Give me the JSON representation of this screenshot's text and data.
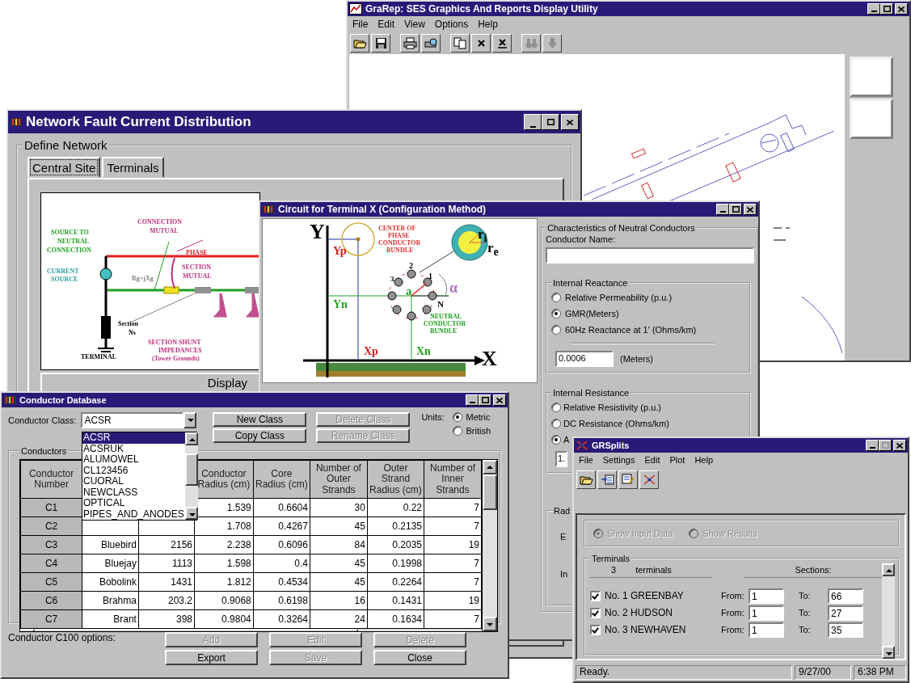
{
  "grarep": {
    "title": "GraRep: SES Graphics And Reports Display Utility",
    "menu": [
      "File",
      "Edit",
      "View",
      "Options",
      "Help"
    ]
  },
  "network": {
    "title": "Network Fault Current Distribution",
    "group": "Define Network",
    "tabs": [
      {
        "label": "Central Site",
        "selected": true
      },
      {
        "label": "Terminals",
        "selected": false
      }
    ],
    "diagram_labels": [
      "SOURCE TO",
      "NEUTRAL",
      "CONNECTION",
      "CONNECTION",
      "MUTUAL",
      "PHASE",
      "CURRENT",
      "SOURCE",
      "Rg+jXg",
      "SECTION",
      "MUTUAL",
      "Section",
      "Ns",
      "SECTION SHUNT",
      "IMPEDANCES",
      "TERMINAL",
      "(Tower Grounds)"
    ],
    "display_button": "Display"
  },
  "circuit": {
    "title": "Circuit for Terminal X (Configuration Method)",
    "diagram_labels": [
      "Y",
      "Yp",
      "CENTER OF",
      "PHASE",
      "CONDUCTOR",
      "BUNDLE",
      "r$_{i}$",
      "r$_{e}$",
      "Yn",
      "2",
      "3",
      "1",
      "a",
      "α",
      "N",
      "NEUTRAL",
      "CONDUCTOR",
      "BUNDLE",
      "Xp",
      "Xn",
      "X"
    ],
    "group": "Characteristics of Neutral Conductors",
    "name_label": "Conductor Name:",
    "reactance": {
      "title": "Internal Reactance",
      "options": [
        {
          "label": "Relative Permeability (p.u.)",
          "selected": false
        },
        {
          "label": "GMR(Meters)",
          "selected": true
        },
        {
          "label": "60Hz Reactance at 1' (Ohms/km)",
          "selected": false
        }
      ],
      "value": "0.0006",
      "unit": "(Meters)"
    },
    "resistance": {
      "title": "Internal Resistance",
      "options": [
        {
          "label": "Relative Resistivity (p.u.)",
          "selected": false
        },
        {
          "label": "DC Resistance (Ohms/km)",
          "selected": false
        },
        {
          "label": "A",
          "selected": true
        }
      ],
      "value": "1."
    },
    "radius": {
      "title": "Rad",
      "lines": [
        "E",
        "In"
      ]
    }
  },
  "conductor_db": {
    "title": "Conductor Database",
    "class_label": "Conductor Class:",
    "class_value": "ACSR",
    "class_options": [
      {
        "label": "ACSR",
        "selected": true
      },
      {
        "label": "ACSRUK",
        "selected": false
      },
      {
        "label": "ALUMOWEL",
        "selected": false
      },
      {
        "label": "CL123456",
        "selected": false
      },
      {
        "label": "CUORAL",
        "selected": false
      },
      {
        "label": "NEWCLASS",
        "selected": false
      },
      {
        "label": "OPTICAL",
        "selected": false
      },
      {
        "label": "PIPES_AND_ANODES",
        "selected": false
      }
    ],
    "top_buttons": [
      {
        "label": "New Class",
        "disabled": false
      },
      {
        "label": "Delete Class",
        "disabled": true
      },
      {
        "label": "Copy Class",
        "disabled": false
      },
      {
        "label": "Rename Class",
        "disabled": true
      }
    ],
    "units_label": "Units:",
    "units": [
      {
        "label": "Metric",
        "selected": true
      },
      {
        "label": "British",
        "selected": false
      }
    ],
    "group": "Conductors",
    "table": {
      "columns": [
        "Conductor Number",
        "",
        "",
        "Conductor Radius (cm)",
        "Core Radius (cm)",
        "Number of Outer Strands",
        "Outer Strand Radius (cm)",
        "Number of Inner Strands"
      ],
      "rows": [
        [
          "C1",
          "",
          "",
          "1.539",
          "0.6604",
          "30",
          "0.22",
          "7"
        ],
        [
          "C2",
          "",
          "",
          "1.708",
          "0.4267",
          "45",
          "0.2135",
          "7"
        ],
        [
          "C3",
          "Bluebird",
          "2156",
          "2.238",
          "0.6096",
          "84",
          "0.2035",
          "19"
        ],
        [
          "C4",
          "Bluejay",
          "1113",
          "1.598",
          "0.4",
          "45",
          "0.1998",
          "7"
        ],
        [
          "C5",
          "Bobolink",
          "1431",
          "1.812",
          "0.4534",
          "45",
          "0.2264",
          "7"
        ],
        [
          "C6",
          "Brahma",
          "203.2",
          "0.9068",
          "0.6198",
          "16",
          "0.1431",
          "19"
        ],
        [
          "C7",
          "Brant",
          "398",
          "0.9804",
          "0.3264",
          "24",
          "0.1634",
          "7"
        ]
      ]
    },
    "options_note": "Conductor C100 options:",
    "bottom_buttons": [
      {
        "label": "Add",
        "disabled": true
      },
      {
        "label": "Edit",
        "disabled": true
      },
      {
        "label": "Delete",
        "disabled": true
      },
      {
        "label": "Export",
        "disabled": false
      },
      {
        "label": "Save",
        "disabled": true
      },
      {
        "label": "Close",
        "disabled": false
      }
    ]
  },
  "grsplits": {
    "title": "GRSplits",
    "menu": [
      "File",
      "Settings",
      "Edit",
      "Plot",
      "Help"
    ],
    "view": [
      {
        "label": "Show Input Data",
        "selected": true
      },
      {
        "label": "Show Results",
        "selected": false
      }
    ],
    "group": "Terminals",
    "count": "3",
    "count_label": "terminals",
    "sections_label": "Sections:",
    "terminals": [
      {
        "name": "No. 1 GREENBAY",
        "checked": true,
        "from_label": "From:",
        "from": "1",
        "to_label": "To:",
        "to": "66"
      },
      {
        "name": "No. 2 HUDSON",
        "checked": true,
        "from_label": "From:",
        "from": "1",
        "to_label": "To:",
        "to": "27"
      },
      {
        "name": "No. 3 NEWHAVEN",
        "checked": true,
        "from_label": "From:",
        "from": "1",
        "to_label": "To:",
        "to": "35"
      }
    ],
    "status": [
      "Ready.",
      "9/27/00",
      "6:38 PM"
    ]
  }
}
